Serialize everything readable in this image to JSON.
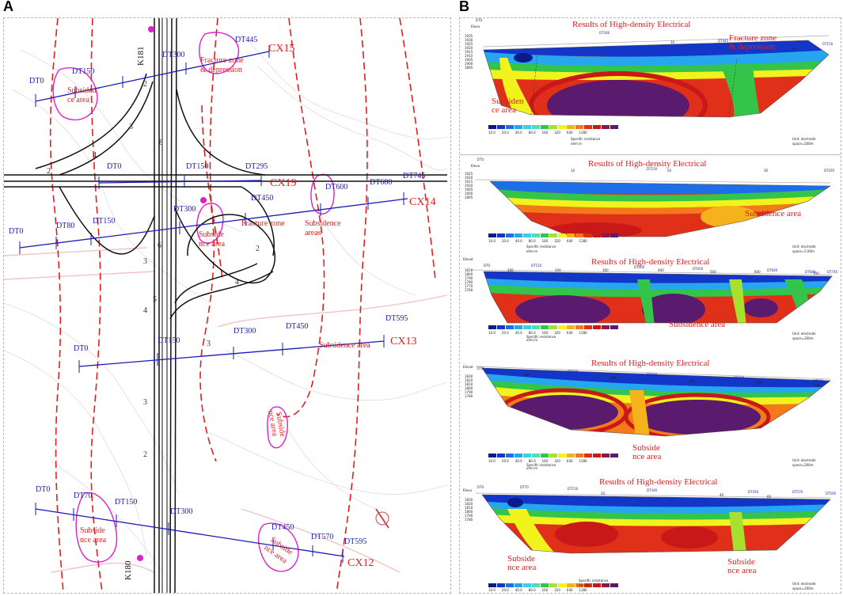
{
  "panel_labels": {
    "a": "A",
    "b": "B"
  },
  "colors": {
    "line_blue": "#1a1ab8",
    "text_red": "#e02020",
    "magenta": "#e020c8",
    "fault_red": "#e02020",
    "road_black": "#111111",
    "resistivity_scale": [
      "#0b1a8a",
      "#1436c8",
      "#1e6eea",
      "#27a6f0",
      "#36d1ea",
      "#4ee0b0",
      "#34c44a",
      "#a7e02f",
      "#f2f21c",
      "#f6b21a",
      "#f27a18",
      "#e0301a",
      "#c81818",
      "#8a1a4a",
      "#5a1a6e"
    ]
  },
  "map": {
    "profiles": [
      {
        "id": "CX15",
        "points": [
          "DT0",
          "DT150",
          "DT300",
          "DT445"
        ]
      },
      {
        "id": "CX19",
        "points": [
          "DT0",
          "DT150",
          "DT295"
        ]
      },
      {
        "id": "CX14",
        "points": [
          "DT0",
          "DT80",
          "DT150",
          "DT300",
          "DT450",
          "DT600",
          "DT680",
          "DT745"
        ]
      },
      {
        "id": "CX13",
        "points": [
          "DT0",
          "DT150",
          "DT300",
          "DT450",
          "DT595"
        ]
      },
      {
        "id": "CX12",
        "points": [
          "DT0",
          "DT70",
          "DT150",
          "DT300",
          "DT450",
          "DT570",
          "DT595"
        ]
      }
    ],
    "stakes": [
      "K181",
      "K180"
    ],
    "zone_labels": {
      "subsidence_1a": "Subsiden",
      "subsidence_1b": "ce area",
      "fracture_1a": "Fracture zone",
      "fracture_1b": "& depression",
      "subside_2a": "Subside",
      "subside_2b": "nce area",
      "fracture_2": "Fracture zone",
      "subsidence_area_a": "Subsidence",
      "subsidence_area_b": "areas",
      "subsidence_area_cx13": "Subsidence area",
      "subside_3a": "Subside",
      "subside_3b": "nce area",
      "subside_4a": "Subside",
      "subside_4b": "nce area",
      "subside_5a": "Subside",
      "subside_5b": "nce area"
    },
    "ramp_numbers": [
      "2",
      "3",
      "8",
      "4",
      "2",
      "6",
      "3",
      "2",
      "4",
      "4",
      "3",
      "5",
      "3",
      "2"
    ]
  },
  "sections": [
    {
      "title": "Results of High-density Electrical",
      "notes": [
        {
          "a": "Fracture zone",
          "b": "& depression"
        },
        {
          "a": "Subsiden",
          "b": "ce area"
        }
      ],
      "markers": [
        "DT0",
        "DT300",
        "DT445",
        "DT150"
      ],
      "ticks": [
        "10",
        "40"
      ],
      "axis_label": "Eleva",
      "depth_ticks": [
        "1935",
        "1930",
        "1925",
        "1920",
        "1915",
        "1910",
        "1905",
        "1900",
        "1895"
      ],
      "legend_values": [
        "10.0",
        "20.0",
        "40.0",
        "80.0",
        "160",
        "320",
        "640",
        "1280"
      ],
      "legend_caption_a": "Specific resistance",
      "legend_caption_b": "ohm.m",
      "unit_a": "Unit: electrode",
      "unit_b": "space=200m"
    },
    {
      "title": "Results of High-density Electrical",
      "notes": [
        {
          "a": "Subsidence area",
          "b": ""
        }
      ],
      "markers": [
        "DT0",
        "DT150",
        "DT295"
      ],
      "ticks": [
        "10",
        "20",
        "30"
      ],
      "axis_label": "Eleva",
      "depth_ticks": [
        "1925",
        "1920",
        "1915",
        "1910",
        "1905",
        "1900",
        "1895"
      ],
      "legend_values": [
        "10.0",
        "20.0",
        "40.0",
        "80.0",
        "160",
        "320",
        "640",
        "1280"
      ],
      "legend_caption_a": "Specific resistance",
      "legend_caption_b": "ohm.m",
      "unit_a": "Unit: electrode",
      "unit_b": "space=5.00m"
    },
    {
      "title": "Results of High-density Electrical",
      "notes": [
        {
          "a": "Subsidence area",
          "b": ""
        }
      ],
      "markers": [
        "DT0",
        "DT150",
        "DT300",
        "DT450",
        "DT600",
        "DT680",
        "DT745"
      ],
      "ticks": [
        "100",
        "200",
        "300",
        "400",
        "500",
        "600",
        "700"
      ],
      "axis_label": "Elevat",
      "depth_ticks": [
        "1810",
        "1800",
        "1790",
        "1780",
        "1770",
        "1760"
      ],
      "legend_values": [
        "10.0",
        "20.0",
        "40.0",
        "80.0",
        "160",
        "320",
        "640",
        "1280"
      ],
      "legend_caption_a": "Specific resistance",
      "legend_caption_b": "ohm.m",
      "unit_a": "Unit: electrode",
      "unit_b": "space=200m"
    },
    {
      "title": "Results of High-density Electrical",
      "notes": [
        {
          "a": "Subside",
          "b": "nce area"
        }
      ],
      "markers": [
        "DT0",
        "DT150",
        "DT300",
        "DT450",
        "DT595"
      ],
      "ticks": [
        "100",
        "200",
        "300",
        "400",
        "500"
      ],
      "axis_label": "Elevat",
      "depth_ticks": [
        "1830",
        "1820",
        "1810",
        "1800",
        "1790",
        "1780"
      ],
      "legend_values": [
        "10.0",
        "20.0",
        "40.0",
        "80.0",
        "160",
        "320",
        "640",
        "1280"
      ],
      "legend_caption_a": "Specific resistance",
      "legend_caption_b": "ohm.m",
      "unit_a": "Unit: electrode",
      "unit_b": "space=200m"
    },
    {
      "title": "Results of High-density Electrical",
      "notes": [
        {
          "a": "Subside",
          "b": "nce area"
        },
        {
          "a": "Subside",
          "b": "nce area"
        }
      ],
      "markers": [
        "DT0",
        "DT70",
        "DT150",
        "DT300",
        "DT450",
        "DT570",
        "DT595"
      ],
      "ticks": [
        "20",
        "40",
        "60"
      ],
      "axis_label": "Eleva",
      "depth_ticks": [
        "1830",
        "1820",
        "1810",
        "1800",
        "1790",
        "1780"
      ],
      "legend_values": [
        "10.0",
        "20.0",
        "40.0",
        "80.0",
        "160",
        "320",
        "640",
        "1280"
      ],
      "legend_caption_a": "Specific resistance",
      "legend_caption_b": "ohm.m",
      "unit_a": "Unit: electrode",
      "unit_b": "space=200m"
    }
  ]
}
